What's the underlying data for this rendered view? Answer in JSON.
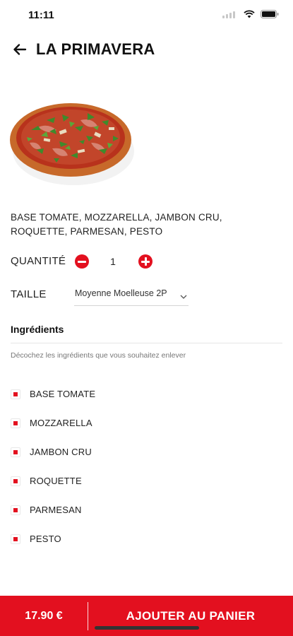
{
  "status_bar": {
    "time": "11:11"
  },
  "header": {
    "title": "LA PRIMAVERA"
  },
  "product": {
    "description": "BASE TOMATE, MOZZARELLA, JAMBON CRU, ROQUETTE, PARMESAN, PESTO"
  },
  "quantity": {
    "label": "QUANTITÉ",
    "value": "1"
  },
  "size": {
    "label": "TAILLE",
    "selected": "Moyenne Moelleuse 2P"
  },
  "ingredients": {
    "title": "Ingrédients",
    "hint": "Décochez les ingrédients que vous souhaitez enlever",
    "items": [
      "BASE TOMATE",
      "MOZZARELLA",
      "JAMBON CRU",
      "ROQUETTE",
      "PARMESAN",
      "PESTO"
    ]
  },
  "bottom_bar": {
    "price": "17.90 €",
    "add_label": "AJOUTER AU PANIER"
  },
  "colors": {
    "accent": "#e3101f"
  },
  "icons": [
    "back-arrow-icon",
    "minus-icon",
    "plus-icon",
    "chevron-down-icon",
    "wifi-icon",
    "battery-icon",
    "signal-icon"
  ]
}
